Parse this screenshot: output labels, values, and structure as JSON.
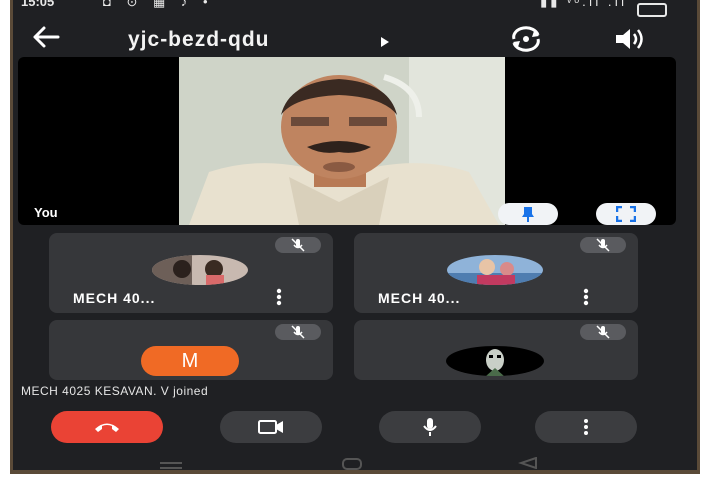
{
  "status_bar": {
    "time": "15:05",
    "left_icons": "◘ ⊙ ▦ ♪ •",
    "right_icons": "▮▮ ᵛᵒ.ıl .ıl"
  },
  "toolbar": {
    "title": "yjc-bezd-qdu"
  },
  "self_view": {
    "label": "You"
  },
  "participants": [
    {
      "name": "MECH 40..."
    },
    {
      "name": "MECH 40..."
    },
    {
      "initial": "M"
    },
    {}
  ],
  "notification": "MECH 4025 KESAVAN. V joined",
  "icons": [
    "back-arrow-icon",
    "play-caret-icon",
    "switch-camera-icon",
    "speaker-icon",
    "pin-icon",
    "fullscreen-icon",
    "mic-off-icon",
    "kebab-icon",
    "end-call-icon",
    "camera-icon",
    "mic-icon",
    "more-vert-icon"
  ],
  "colors": {
    "end_call": "#ea4335",
    "avatar_m": "#f06a25",
    "tile": "#36373a",
    "background": "#1f2023"
  }
}
